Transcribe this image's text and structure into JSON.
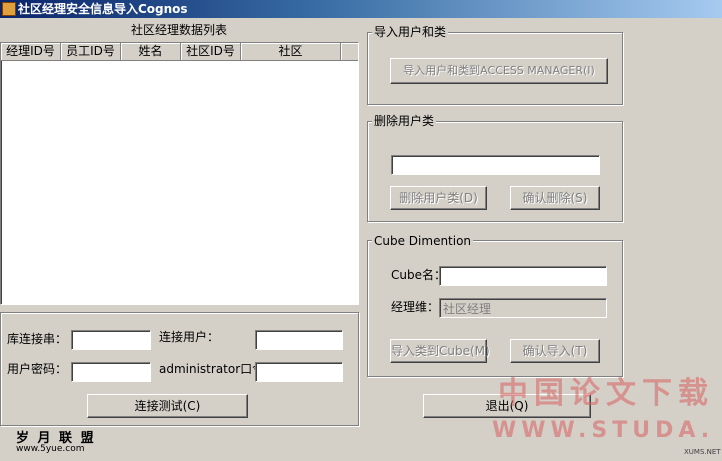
{
  "window": {
    "title": "社区经理安全信息导入Cognos"
  },
  "list_panel": {
    "title": "社区经理数据列表",
    "columns": [
      "经理ID号",
      "员工ID号",
      "姓名",
      "社区ID号",
      "社区"
    ],
    "rows": []
  },
  "connection": {
    "db_conn_label": "库连接串：",
    "db_conn_value": "",
    "conn_user_label": "连接用户：",
    "conn_user_value": "",
    "user_pwd_label": "用户密码：",
    "user_pwd_value": "",
    "admin_pwd_label": "administrator口令：",
    "admin_pwd_value": "",
    "test_button": "连接测试(C)"
  },
  "import_group": {
    "label": "导入用户和类",
    "import_button": "导入用户和类到ACCESS MANAGER(I)"
  },
  "delete_group": {
    "label": "删除用户类",
    "input_value": "",
    "delete_button": "删除用户类(D)",
    "confirm_button": "确认删除(S)"
  },
  "cube_group": {
    "label": "Cube Dimention",
    "cube_name_label": "Cube名：",
    "cube_name_value": "",
    "manager_dim_label": "经理维：",
    "manager_dim_placeholder": "社区经理",
    "import_cube_button": "导入类到Cube(M)",
    "confirm_import_button": "确认导入(T)"
  },
  "exit_button": "退出(Q)",
  "watermarks": {
    "left_logo": "岁 月 联 盟",
    "left_url": "www.5yue.com",
    "right_cn": "中国论文下载",
    "right_url": "WWW.STUDA.",
    "right_small": "XUMS.NET"
  }
}
